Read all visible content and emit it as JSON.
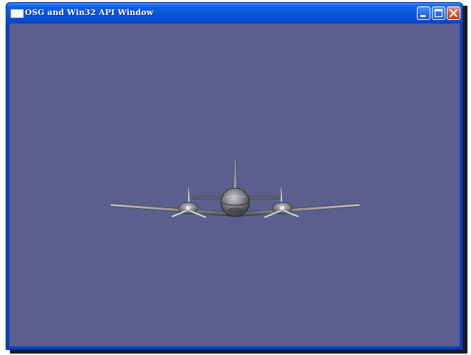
{
  "window": {
    "title": "OSG and Win32 API Window",
    "icon": "window-app-icon",
    "controls": {
      "minimize_icon": "minimize-icon",
      "maximize_icon": "maximize-icon",
      "close_icon": "close-icon"
    }
  },
  "viewport": {
    "background_color": "#5c5e8e",
    "scene_object": "airplane-3d-model"
  },
  "colors": {
    "titlebar": "#0a55d8",
    "close_button": "#d84a22"
  }
}
